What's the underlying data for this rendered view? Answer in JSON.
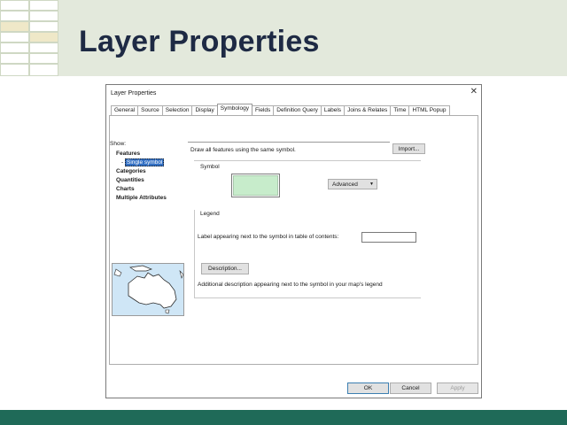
{
  "slide": {
    "title": "Layer Properties",
    "colors": {
      "header_bg": "#e3e9dc",
      "title": "#1e2a44",
      "footer": "#1f6a58"
    }
  },
  "dialog": {
    "title": "Layer Properties",
    "tabs": [
      "General",
      "Source",
      "Selection",
      "Display",
      "Symbology",
      "Fields",
      "Definition Query",
      "Labels",
      "Joins & Relates",
      "Time",
      "HTML Popup"
    ],
    "active_tab": "Symbology",
    "show": {
      "label": "Show:",
      "features": "Features",
      "single_symbol": "Single symbol",
      "categories": "Categories",
      "quantities": "Quantities",
      "charts": "Charts",
      "multiple_attributes": "Multiple Attributes"
    },
    "draw_description": "Draw all features using the same symbol.",
    "import_button": "Import...",
    "symbol_label": "Symbol",
    "symbol_color": "#c7eccb",
    "advanced_button": "Advanced",
    "legend_label": "Legend",
    "label_prompt": "Label appearing next to the symbol in table of contents:",
    "label_value": "",
    "description_button": "Description...",
    "description_prompt": "Additional description appearing next to the symbol in your map's legend",
    "ok_button": "OK",
    "cancel_button": "Cancel",
    "apply_button": "Apply"
  }
}
